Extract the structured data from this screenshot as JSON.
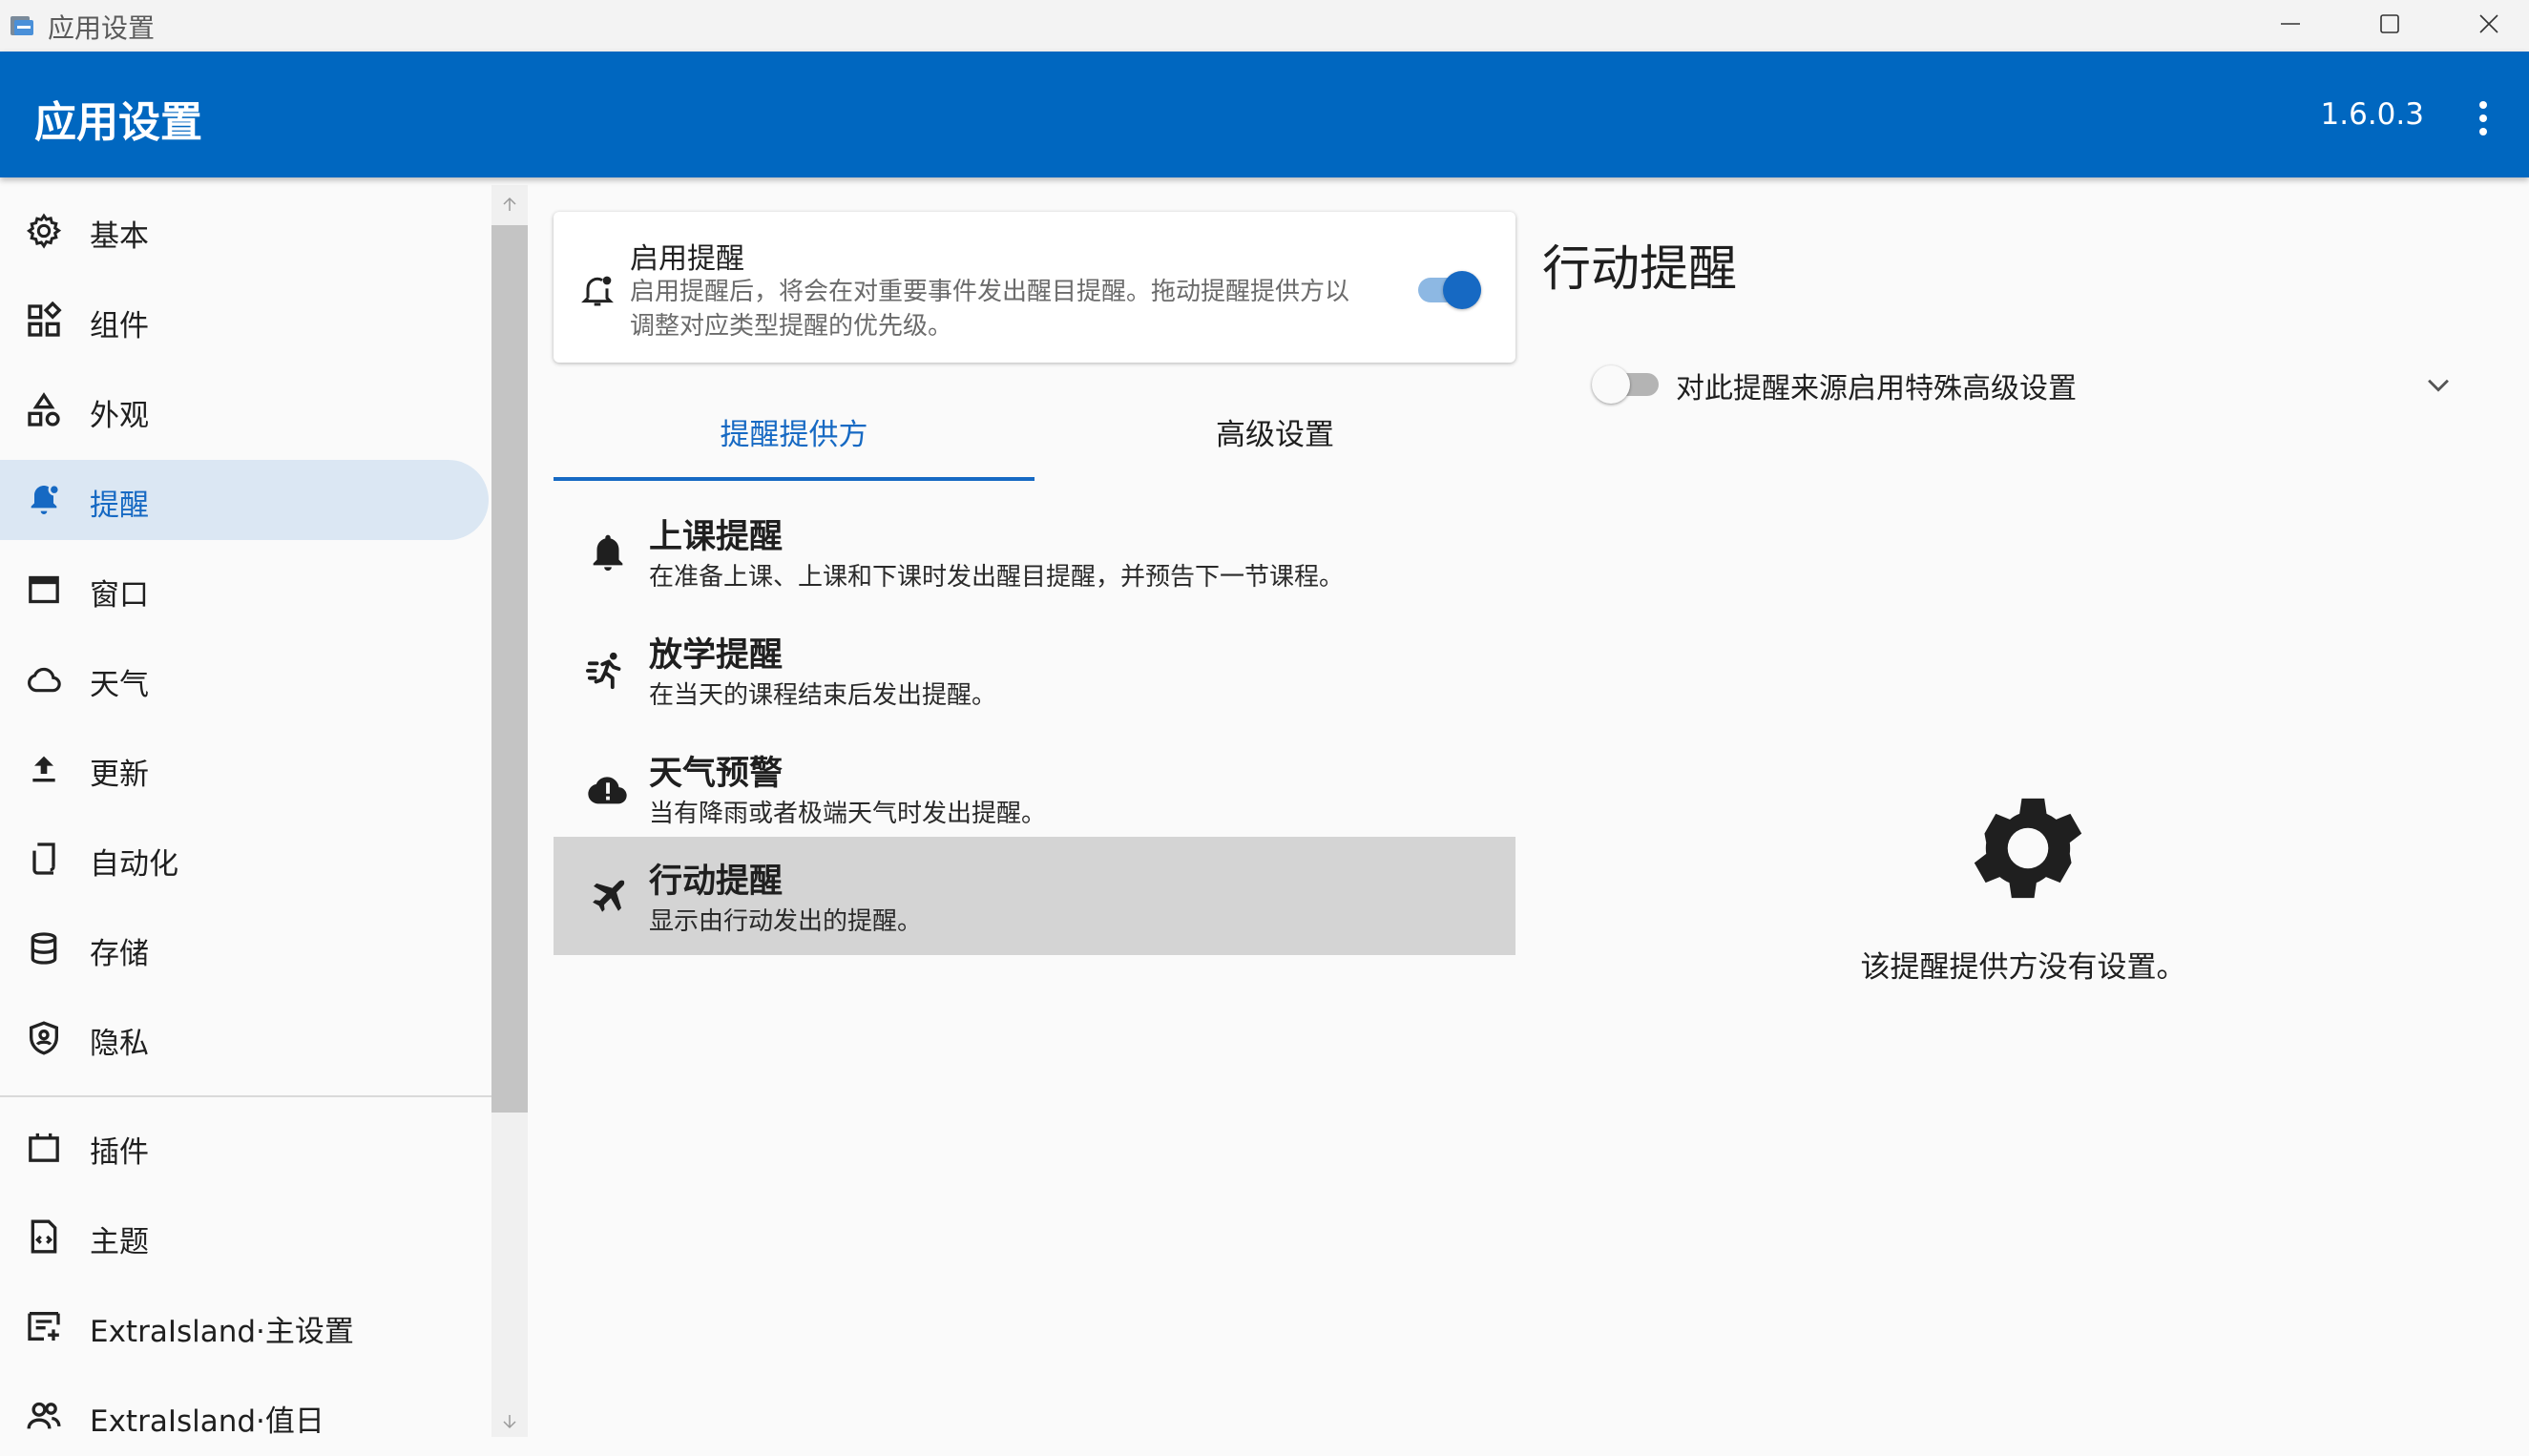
{
  "window": {
    "title": "应用设置",
    "controls": [
      "minimize",
      "maximize",
      "close"
    ]
  },
  "header": {
    "title": "应用设置",
    "version": "1.6.0.3",
    "more_icon": "more-vertical-icon",
    "color": "#0067c0"
  },
  "sidebar": {
    "items": [
      {
        "label": "基本",
        "icon": "gear-icon",
        "active": false
      },
      {
        "label": "组件",
        "icon": "widgets-icon",
        "active": false
      },
      {
        "label": "外观",
        "icon": "shapes-icon",
        "active": false
      },
      {
        "label": "提醒",
        "icon": "notification-bell-icon",
        "active": true
      },
      {
        "label": "窗口",
        "icon": "window-icon",
        "active": false
      },
      {
        "label": "天气",
        "icon": "cloud-icon",
        "active": false
      },
      {
        "label": "更新",
        "icon": "upload-icon",
        "active": false
      },
      {
        "label": "自动化",
        "icon": "automation-icon",
        "active": false
      },
      {
        "label": "存储",
        "icon": "database-icon",
        "active": false
      },
      {
        "label": "隐私",
        "icon": "privacy-shield-icon",
        "active": false
      }
    ],
    "plugin_items": [
      {
        "label": "插件",
        "icon": "plugin-icon"
      },
      {
        "label": "主题",
        "icon": "theme-file-icon"
      },
      {
        "label": "ExtraIsland·主设置",
        "icon": "settings-add-icon"
      },
      {
        "label": "ExtraIsland·值日",
        "icon": "people-icon"
      }
    ]
  },
  "enable_card": {
    "title": "启用提醒",
    "description": "启用提醒后，将会在对重要事件发出醒目提醒。拖动提醒提供方以调整对应类型提醒的优先级。",
    "enabled": true
  },
  "tabs": [
    {
      "label": "提醒提供方",
      "active": true
    },
    {
      "label": "高级设置",
      "active": false
    }
  ],
  "providers": [
    {
      "title": "上课提醒",
      "description": "在准备上课、上课和下课时发出醒目提醒，并预告下一节课程。",
      "icon": "bell-icon",
      "selected": false
    },
    {
      "title": "放学提醒",
      "description": "在当天的课程结束后发出提醒。",
      "icon": "running-icon",
      "selected": false
    },
    {
      "title": "天气预警",
      "description": "当有降雨或者极端天气时发出提醒。",
      "icon": "cloud-alert-icon",
      "selected": false
    },
    {
      "title": "行动提醒",
      "description": "显示由行动发出的提醒。",
      "icon": "airplane-icon",
      "selected": true
    }
  ],
  "detail": {
    "title": "行动提醒",
    "advanced_toggle_label": "对此提醒来源启用特殊高级设置",
    "advanced_enabled": false,
    "empty_message": "该提醒提供方没有设置。",
    "empty_icon": "gear-icon"
  },
  "colors": {
    "accent": "#1669c3",
    "selected_row": "#d4d4d4",
    "active_nav": "#dbe7f3"
  }
}
